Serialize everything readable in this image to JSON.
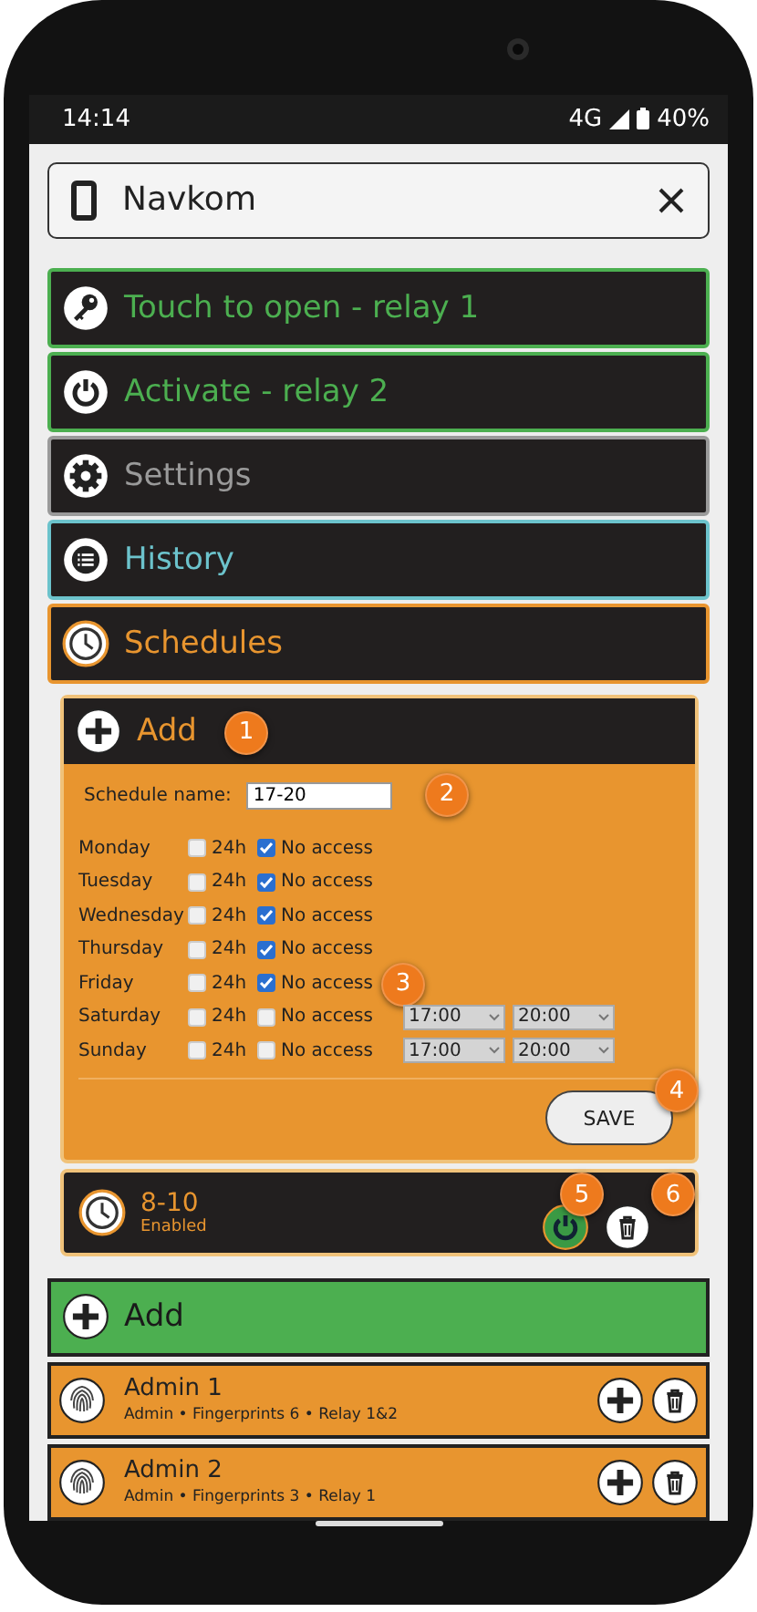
{
  "status_bar": {
    "time": "14:14",
    "network": "4G",
    "battery": "40%"
  },
  "header": {
    "title": "Navkom"
  },
  "menu": [
    {
      "label": "Touch to open - relay 1",
      "color": "#4caf50"
    },
    {
      "label": "Activate - relay 2",
      "color": "#4caf50"
    },
    {
      "label": "Settings",
      "color": "#9a9a9a"
    },
    {
      "label": "History",
      "color": "#6cc3cc"
    },
    {
      "label": "Schedules",
      "color": "#e8952f"
    }
  ],
  "schedule_form": {
    "title": "Add",
    "name_label": "Schedule name:",
    "name_value": "17-20",
    "save": "SAVE",
    "days": [
      {
        "day": "Monday",
        "all_day_label": "24h",
        "all_day": false,
        "no_access_label": "No access",
        "no_access": true
      },
      {
        "day": "Tuesday",
        "all_day_label": "24h",
        "all_day": false,
        "no_access_label": "No access",
        "no_access": true
      },
      {
        "day": "Wednesday",
        "all_day_label": "24h",
        "all_day": false,
        "no_access_label": "No access",
        "no_access": true
      },
      {
        "day": "Thursday",
        "all_day_label": "24h",
        "all_day": false,
        "no_access_label": "No access",
        "no_access": true
      },
      {
        "day": "Friday",
        "all_day_label": "24h",
        "all_day": false,
        "no_access_label": "No access",
        "no_access": true
      },
      {
        "day": "Saturday",
        "all_day_label": "24h",
        "all_day": false,
        "no_access_label": "No access",
        "no_access": false,
        "from": "17:00",
        "to": "20:00"
      },
      {
        "day": "Sunday",
        "all_day_label": "24h",
        "all_day": false,
        "no_access_label": "No access",
        "no_access": false,
        "from": "17:00",
        "to": "20:00"
      }
    ]
  },
  "schedules": [
    {
      "name": "8-10",
      "status": "Enabled",
      "enabled": true
    }
  ],
  "add_user": {
    "label": "Add"
  },
  "users": [
    {
      "name": "Admin 1",
      "details": "Admin • Fingerprints 6 • Relay 1&2"
    },
    {
      "name": "Admin 2",
      "details": "Admin • Fingerprints 3 • Relay 1"
    }
  ],
  "annotations": [
    "1",
    "2",
    "3",
    "4",
    "5",
    "6"
  ]
}
